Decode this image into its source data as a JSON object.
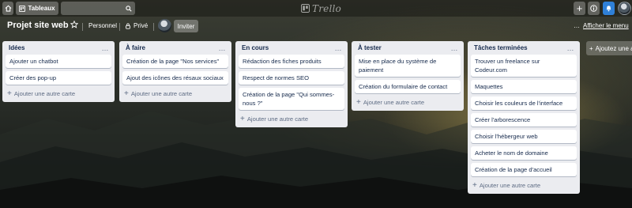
{
  "topbar": {
    "boards_label": "Tableaux",
    "search_value": "",
    "logo_text": "Trello"
  },
  "board": {
    "title": "Projet site web",
    "workspace": "Personnel",
    "visibility": "Privé",
    "invite_label": "Inviter",
    "menu_label": "Afficher le menu",
    "more_dots": "…"
  },
  "lists": [
    {
      "title": "Idées",
      "cards": [
        "Ajouter un chatbot",
        "Créer des pop-up"
      ],
      "add_label": "Ajouter une autre carte"
    },
    {
      "title": "À faire",
      "cards": [
        "Création de la page \"Nos services\"",
        "Ajout des icônes des résaux sociaux"
      ],
      "add_label": "Ajouter une autre carte"
    },
    {
      "title": "En cours",
      "cards": [
        "Rédaction des fiches produits",
        "Respect de normes SEO",
        "Création de la page \"Qui sommes-nous ?\""
      ],
      "add_label": "Ajouter une autre carte"
    },
    {
      "title": "À tester",
      "cards": [
        "Mise en place du système de paiement",
        "Création du formulaire de contact"
      ],
      "add_label": "Ajouter une autre carte"
    },
    {
      "title": "Tâches terminées",
      "cards": [
        "Trouver un freelance sur Codeur.com",
        "Maquettes",
        "Choisir les couleurs de l'interface",
        "Créer l'arborescence",
        "Choisir l'hébergeur web",
        "Acheter le nom de domaine",
        "Création de la page d'accueil"
      ],
      "add_label": "Ajouter une autre carte"
    }
  ],
  "add_list_label": "Ajoutez une autre liste",
  "icons": {
    "home": "home-icon",
    "boards": "boards-icon",
    "search": "search-icon",
    "add": "plus-icon",
    "info": "info-icon",
    "notifications": "bell-icon",
    "star": "star-icon",
    "visibility": "lock-icon",
    "more": "ellipsis-icon"
  },
  "colors": {
    "list_bg": "#ebecf0",
    "card_text": "#172b4d",
    "notif_accent": "#2f80d8"
  }
}
